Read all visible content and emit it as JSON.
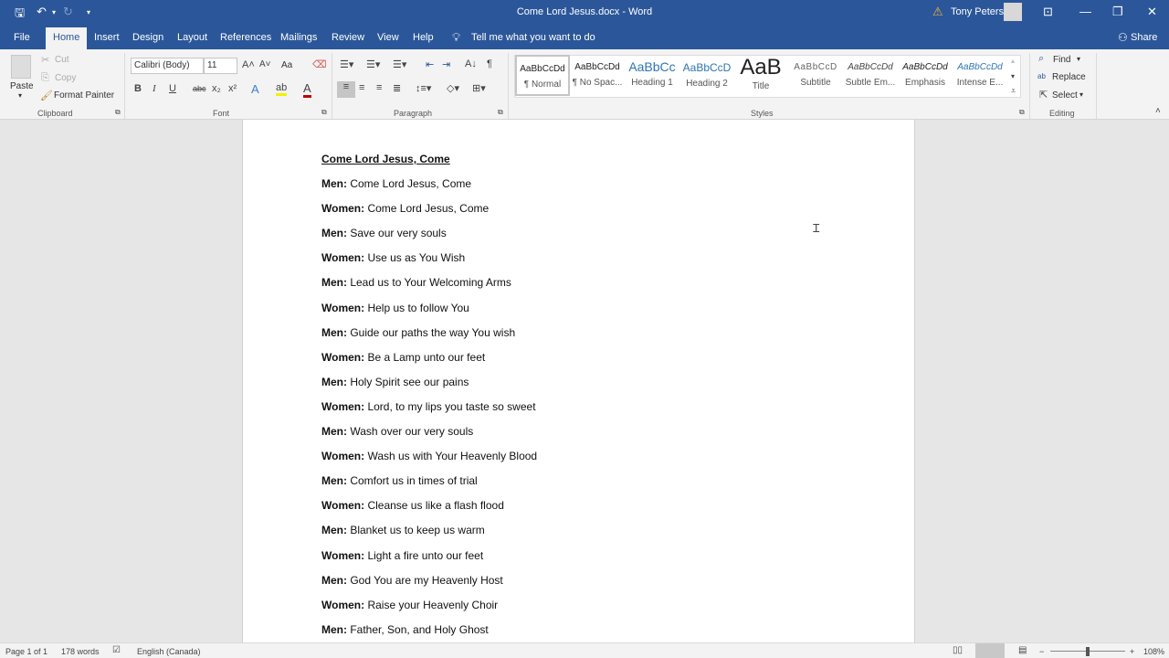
{
  "window": {
    "title": "Come Lord Jesus.docx  -  Word",
    "user_name": "Tony Peters"
  },
  "quick_access": {
    "save": "save-icon",
    "undo": "undo-icon",
    "redo": "redo-icon",
    "customize": "customize-icon"
  },
  "tabs": [
    {
      "label": "File"
    },
    {
      "label": "Home"
    },
    {
      "label": "Insert"
    },
    {
      "label": "Design"
    },
    {
      "label": "Layout"
    },
    {
      "label": "References"
    },
    {
      "label": "Mailings"
    },
    {
      "label": "Review"
    },
    {
      "label": "View"
    },
    {
      "label": "Help"
    }
  ],
  "tell_me": "Tell me what you want to do",
  "share": "Share",
  "clipboard": {
    "paste": "Paste",
    "cut": "Cut",
    "copy": "Copy",
    "format_painter": "Format Painter",
    "label": "Clipboard"
  },
  "font": {
    "name": "Calibri (Body)",
    "size": "11",
    "change_case": "Aa",
    "label": "Font"
  },
  "paragraph": {
    "label": "Paragraph"
  },
  "styles": {
    "label": "Styles",
    "items": [
      {
        "preview": "AaBbCcDd",
        "name": "¶ Normal"
      },
      {
        "preview": "AaBbCcDd",
        "name": "¶ No Spac..."
      },
      {
        "preview": "AaBbCc",
        "name": "Heading 1"
      },
      {
        "preview": "AaBbCcD",
        "name": "Heading 2"
      },
      {
        "preview": "AaB",
        "name": "Title"
      },
      {
        "preview": "AaBbCcD",
        "name": "Subtitle"
      },
      {
        "preview": "AaBbCcDd",
        "name": "Subtle Em..."
      },
      {
        "preview": "AaBbCcDd",
        "name": "Emphasis"
      },
      {
        "preview": "AaBbCcDd",
        "name": "Intense E..."
      }
    ]
  },
  "editing": {
    "find": "Find",
    "replace": "Replace",
    "select": "Select",
    "label": "Editing"
  },
  "document": {
    "heading": "Come Lord Jesus, Come",
    "lines": [
      {
        "speaker": "Men:",
        "text": " Come Lord Jesus, Come"
      },
      {
        "speaker": "Women:",
        "text": " Come Lord Jesus, Come"
      },
      {
        "speaker": "Men:",
        "text": " Save our very souls"
      },
      {
        "speaker": "Women:",
        "text": " Use us as You Wish"
      },
      {
        "speaker": "Men:",
        "text": " Lead us to Your Welcoming Arms"
      },
      {
        "speaker": "Women:",
        "text": " Help us to follow You"
      },
      {
        "speaker": "Men:",
        "text": " Guide our paths the way You wish"
      },
      {
        "speaker": "Women:",
        "text": " Be a Lamp unto our feet"
      },
      {
        "speaker": "Men:",
        "text": " Holy Spirit see our pains"
      },
      {
        "speaker": "Women:",
        "text": " Lord, to my lips you taste so sweet"
      },
      {
        "speaker": "Men:",
        "text": " Wash over our very souls"
      },
      {
        "speaker": "Women:",
        "text": " Wash us with Your Heavenly Blood"
      },
      {
        "speaker": "Men:",
        "text": " Comfort us in times of trial"
      },
      {
        "speaker": "Women:",
        "text": " Cleanse us like a flash flood"
      },
      {
        "speaker": "Men:",
        "text": " Blanket us to keep us warm"
      },
      {
        "speaker": "Women:",
        "text": " Light a fire unto our feet"
      },
      {
        "speaker": "Men:",
        "text": " God You are my Heavenly Host"
      },
      {
        "speaker": "Women:",
        "text": " Raise your Heavenly Choir"
      },
      {
        "speaker": "Men:",
        "text": " Father, Son, and Holy Ghost"
      }
    ]
  },
  "status": {
    "page": "Page 1 of 1",
    "words": "178 words",
    "language": "English (Canada)",
    "zoom": "108%",
    "zoom_minus": "−",
    "zoom_plus": "+"
  },
  "colors": {
    "brand": "#2b579a"
  }
}
